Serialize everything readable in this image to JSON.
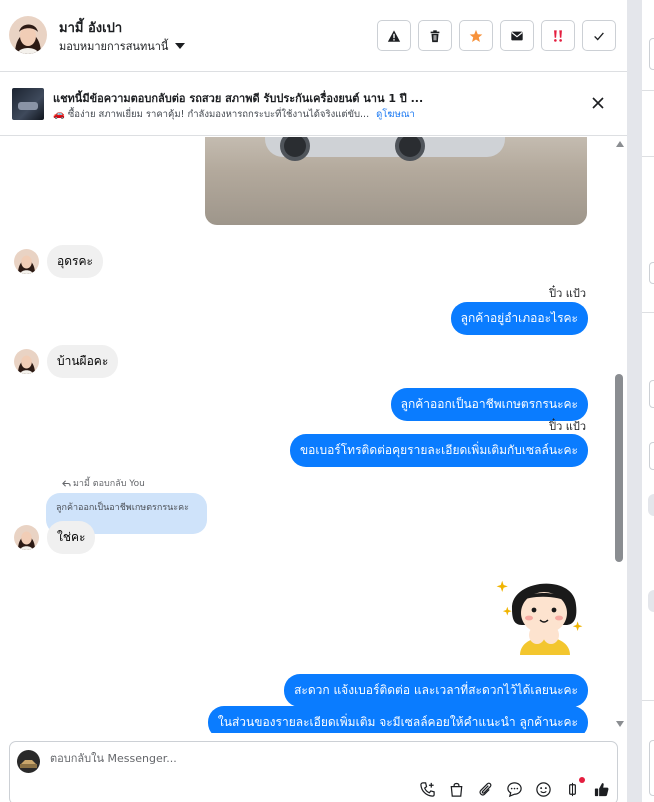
{
  "header": {
    "contact_name": "มามี้ อังเปา",
    "assign_label": "มอบหมายการสนทนานี้",
    "actions": [
      {
        "icon": "warning-icon",
        "label": "Spam"
      },
      {
        "icon": "trash-icon",
        "label": "Delete"
      },
      {
        "icon": "star-icon",
        "label": "Follow up"
      },
      {
        "icon": "envelope-icon",
        "label": "Mark unread"
      },
      {
        "icon": "double-exclamation-icon",
        "label": "Priority"
      },
      {
        "icon": "check-icon",
        "label": "Done"
      }
    ]
  },
  "banner": {
    "title": "แชทนี้มีข้อความตอบกลับต่อ รถสวย สภาพดี รับประกันเครื่องยนต์ นาน 1 ปี ...",
    "subtitle": "🚗 ซื้อง่าย สภาพเยี่ยม ราคาคุ้ม! กำลังมองหารถกระบะที่ใช้งานได้จริงแต่ขับ...",
    "link": "ดูโฆษณา"
  },
  "messages": {
    "m1": "อุดรคะ",
    "sender1": "ปิ๋ว แป้ว",
    "m2": "ลูกค้าอยู่อำเภออะไรคะ",
    "m3": "บ้านผือคะ",
    "m4": "ลูกค้าออกเป็นอาชีพเกษตรกรนะคะ",
    "sender2": "ปิ๋ว แป้ว",
    "m5": "ขอเบอร์โทรติดต่อคุยรายละเอียดเพิ่มเติมกับเซลล์นะคะ",
    "reply_label": "มามี้ ตอบกลับ You",
    "reply_quote": "ลูกค้าออกเป็นอาชีพเกษตรกรนะคะ",
    "m6": "ใช่คะ",
    "m7": "สะดวก แจ้งเบอร์ติดต่อ  และเวลาที่สะดวกไว้ได้เลยนะคะ",
    "m8": "ในส่วนของรายละเอียดเพิ่มเติม จะมีเซลล์คอยให้คำแนะนำ ลูกค้านะคะ"
  },
  "composer": {
    "placeholder": "ตอบกลับใน Messenger..."
  },
  "colors": {
    "outgoing_bubble": "#0a7cff",
    "incoming_bubble": "#f0f0f0",
    "reply_quote_bg": "#cfe3fa",
    "link": "#1877f2",
    "follow_up_star": "#f7923b",
    "priority": "#e41e3f"
  }
}
